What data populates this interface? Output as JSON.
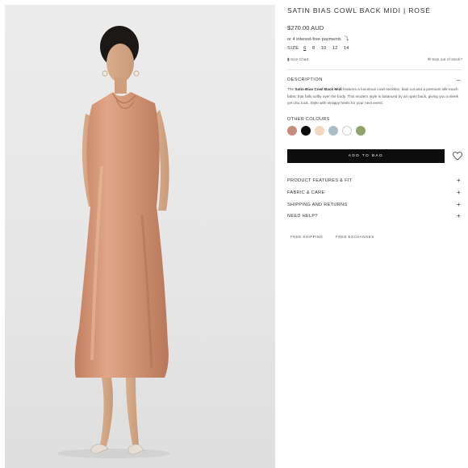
{
  "product": {
    "title": "SATIN BIAS COWL BACK MIDI | ROSÉ",
    "price": "$270.00 AUD",
    "afterpay_text": "or 4 interest-free payments"
  },
  "sizes": {
    "label": "SIZE",
    "options": [
      "6",
      "8",
      "10",
      "12",
      "14"
    ],
    "selected": "6"
  },
  "size_chart_label": "Size Chart",
  "out_of_stock_label": "Size out of stock?",
  "description": {
    "heading": "DESCRIPTION",
    "prefix": "The ",
    "product_name": "Satin Bias Cowl Back Midi",
    "body": " features a luxurious cowl neckline, bias cut and a premium silk-touch fabric that falls softly over the body. This modern style is balanced by an open back, giving you a sleek yet chic look. Style with strappy heels for your next event."
  },
  "other_colours": {
    "label": "OTHER COLOURS",
    "swatches": [
      "#c58c7b",
      "#0b0b0b",
      "#f3d8c0",
      "#a9bdc8",
      "#ffffff",
      "#8fa56d"
    ]
  },
  "add_to_bag_label": "ADD TO BAG",
  "accordions": [
    "PRODUCT FEATURES & FIT",
    "FABRIC & CARE",
    "SHIPPING AND RETURNS",
    "NEED HELP?"
  ],
  "badges": [
    "FREE SHIPPING",
    "FREE EXCHANGES"
  ],
  "icons": {
    "expanded": "minus-icon",
    "collapsed": "plus-icon",
    "wishlist": "heart-icon",
    "size_chart": "ruler-icon",
    "afterpay": "afterpay-icon"
  }
}
